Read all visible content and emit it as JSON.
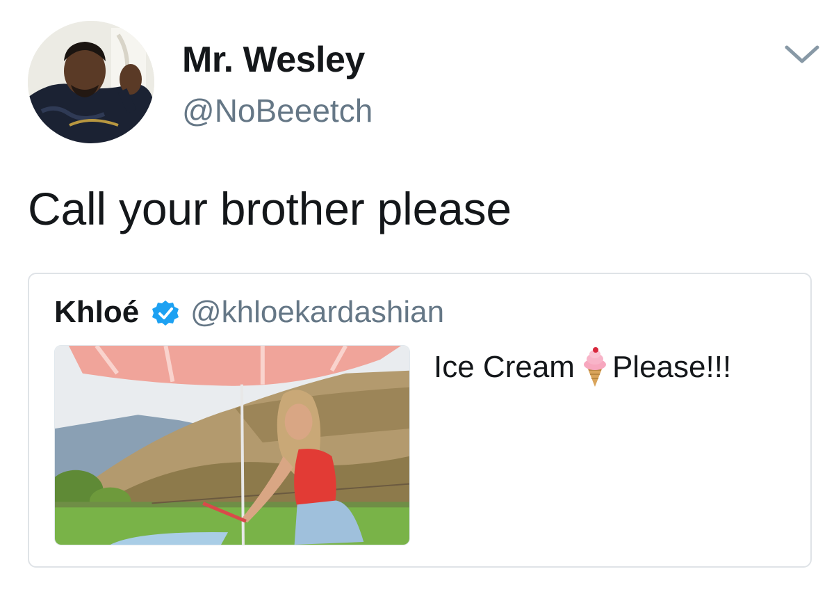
{
  "tweet": {
    "author": {
      "display_name": "Mr. Wesley",
      "handle": "@NoBeeetch"
    },
    "text": "Call your brother please",
    "menu_icon": "chevron-down-icon"
  },
  "quoted_tweet": {
    "author": {
      "display_name": "Khloé",
      "verified": true,
      "handle": "@khloekardashian"
    },
    "text_before_emoji": "Ice Cream",
    "emoji": "ice-cream-icon",
    "text_after_emoji": "Please!!!"
  },
  "colors": {
    "text_primary": "#14171a",
    "text_secondary": "#657786",
    "verified_blue": "#1da1f2",
    "card_border": "#dfe3e7",
    "caret": "#8899a6"
  }
}
